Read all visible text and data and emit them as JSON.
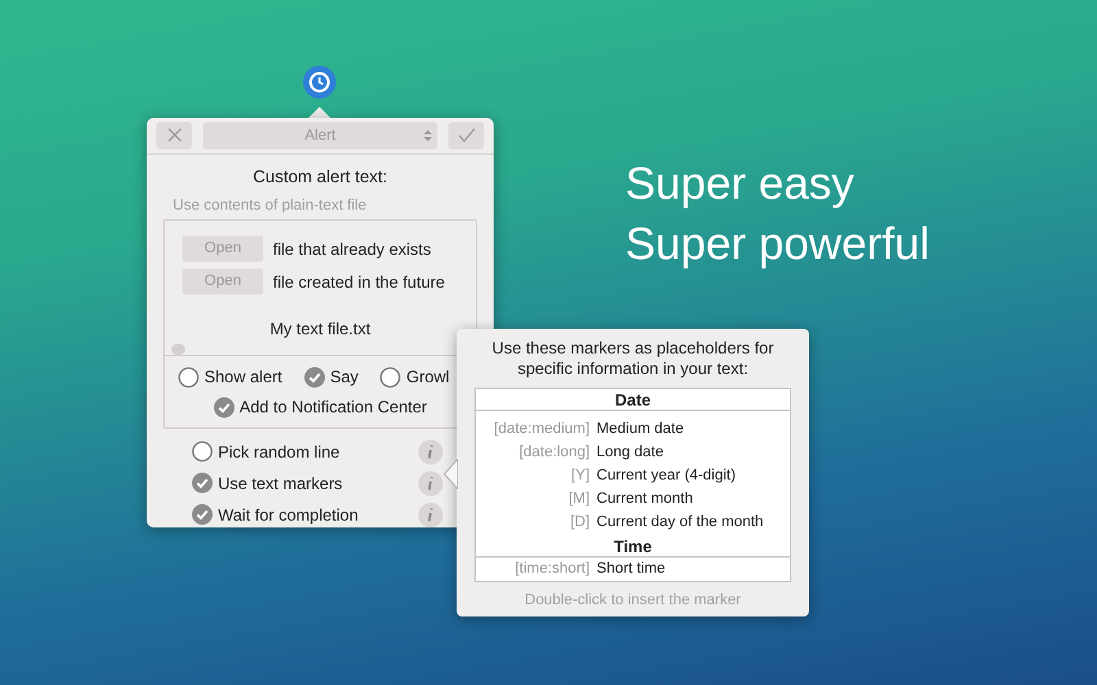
{
  "slogans": [
    "Super easy",
    "Super powerful"
  ],
  "popover": {
    "action_select": "Alert",
    "title": "Custom alert text:",
    "file_label": "Use contents of plain-text file",
    "open_rows": [
      {
        "button": "Open",
        "description": "file that already exists"
      },
      {
        "button": "Open",
        "description": "file created in the future"
      }
    ],
    "file_name": "My text file.txt",
    "outputs": [
      {
        "label": "Show alert",
        "checked": false
      },
      {
        "label": "Say",
        "checked": true
      },
      {
        "label": "Growl",
        "checked": false
      }
    ],
    "notification_center": {
      "label": "Add to Notification Center",
      "checked": true
    },
    "options": [
      {
        "label": "Pick random line",
        "checked": false
      },
      {
        "label": "Use text markers",
        "checked": true
      },
      {
        "label": "Wait for completion",
        "checked": true
      }
    ]
  },
  "marker_help": {
    "intro": "Use these markers as placeholders for specific information in your text:",
    "sections": [
      {
        "heading": "Date",
        "rows": [
          {
            "marker": "[date:medium]",
            "description": "Medium date"
          },
          {
            "marker": "[date:long]",
            "description": "Long date"
          },
          {
            "marker": "[Y]",
            "description": "Current year (4-digit)"
          },
          {
            "marker": "[M]",
            "description": "Current month"
          },
          {
            "marker": "[D]",
            "description": "Current day of the month"
          }
        ]
      },
      {
        "heading": "Time",
        "rows": [
          {
            "marker": "[time:short]",
            "description": "Short time"
          }
        ]
      }
    ],
    "footer": "Double-click to insert the marker"
  }
}
